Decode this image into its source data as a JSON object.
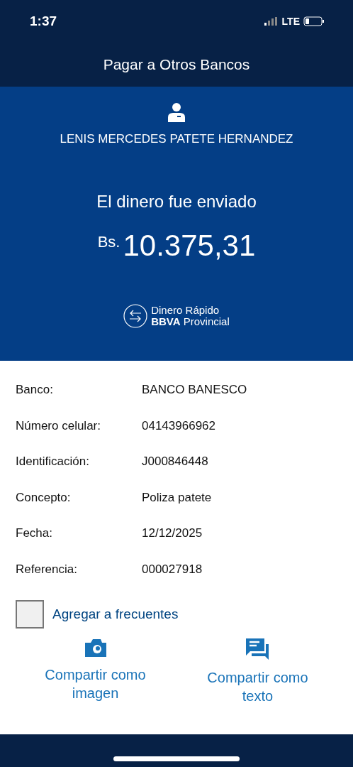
{
  "status_bar": {
    "time": "1:37",
    "network": "LTE"
  },
  "header": {
    "title": "Pagar a Otros Bancos"
  },
  "summary": {
    "recipient": "LENIS MERCEDES PATETE HERNANDEZ",
    "message": "El dinero fue enviado",
    "currency": "Bs.",
    "amount": "10.375,31",
    "brand": {
      "line_1": "Dinero Rápido",
      "line_2": "**BBVA** Provincial"
    }
  },
  "details": [
    {
      "label": "Banco:",
      "value": "BANCO BANESCO"
    },
    {
      "label": "Número celular:",
      "value": "04143966962"
    },
    {
      "label": "Identificación:",
      "value": "J000846448"
    },
    {
      "label": "Concepto:",
      "value": "Poliza patete"
    },
    {
      "label": "Fecha:",
      "value": "12/12/2025"
    },
    {
      "label": "Referencia:",
      "value": "000027918"
    }
  ],
  "favorite": {
    "label": "Agregar a frecuentes",
    "checked": false
  },
  "share_actions": [
    {
      "kind": "image",
      "label": "Compartir como imagen"
    },
    {
      "kind": "text",
      "label": "Compartir como texto"
    }
  ]
}
